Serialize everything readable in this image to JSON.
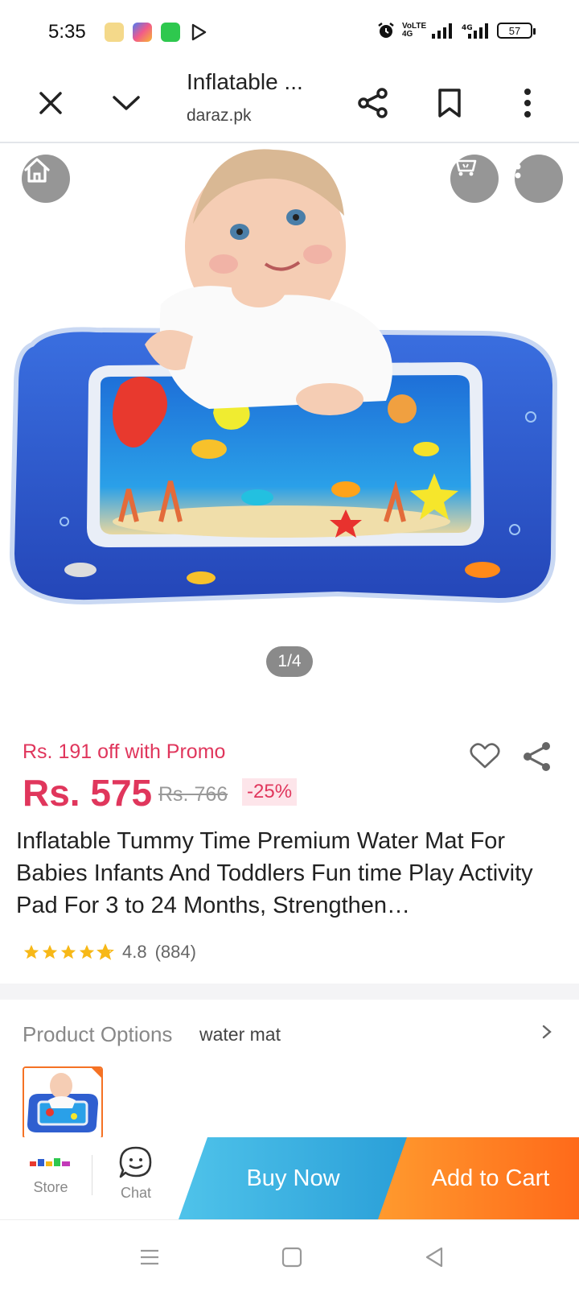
{
  "status_bar": {
    "time": "5:35",
    "network_label": "VoLTE 4G",
    "battery": "57"
  },
  "browser": {
    "title": "Inflatable ...",
    "domain": "daraz.pk"
  },
  "gallery": {
    "counter": "1/4"
  },
  "product": {
    "promo_text": "Rs. 191 off with Promo",
    "price": "Rs. 575",
    "original_price": "Rs. 766",
    "discount": "-25%",
    "title": "Inflatable Tummy Time Premium Water Mat For Babies Infants And Toddlers Fun time Play Activity Pad For 3 to 24 Months, Strengthen…",
    "rating": "4.8",
    "rating_count": "(884)",
    "stars": 4.8
  },
  "options": {
    "label": "Product Options",
    "value": "water mat"
  },
  "actions": {
    "store_label": "Store",
    "chat_label": "Chat",
    "buy_now": "Buy Now",
    "add_to_cart": "Add to Cart"
  },
  "colors": {
    "accent": "#e0365c",
    "buy_now": "#2a9fd8",
    "add_to_cart": "#ff6a1a"
  }
}
